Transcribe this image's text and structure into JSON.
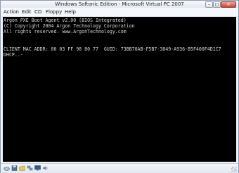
{
  "window": {
    "title": "Windows Softonic Edition - Microsoft Virtual PC 2007",
    "controls": {
      "minimize": "–",
      "maximize": "□",
      "close": "✕"
    }
  },
  "menu": {
    "items": [
      "Action",
      "Edit",
      "CD",
      "Floppy",
      "Help"
    ]
  },
  "console": {
    "lines": [
      "Argon PXE Boot Agent v2.00 (BIOS Integrated)",
      "(C) Copyright 2004 Argon Technology Corporation",
      "All rights reserved. www.ArgonTechnology.com",
      "CLIENT MAC ADDR: 00 03 FF 98 80 77  GUID: 73BB70AB-F5B7-3849-A936-B5F400F4D1C7",
      "DHCP..-"
    ]
  },
  "statusbar": {
    "icons": [
      "cd-drive-icon",
      "floppy-drive-icon",
      "folder-icon",
      "network-icon",
      "monitor-icon",
      "speaker-icon"
    ]
  },
  "colors": {
    "console_background": "#000000",
    "console_text": "#d6d6d6",
    "chrome": "#eef2f7"
  }
}
